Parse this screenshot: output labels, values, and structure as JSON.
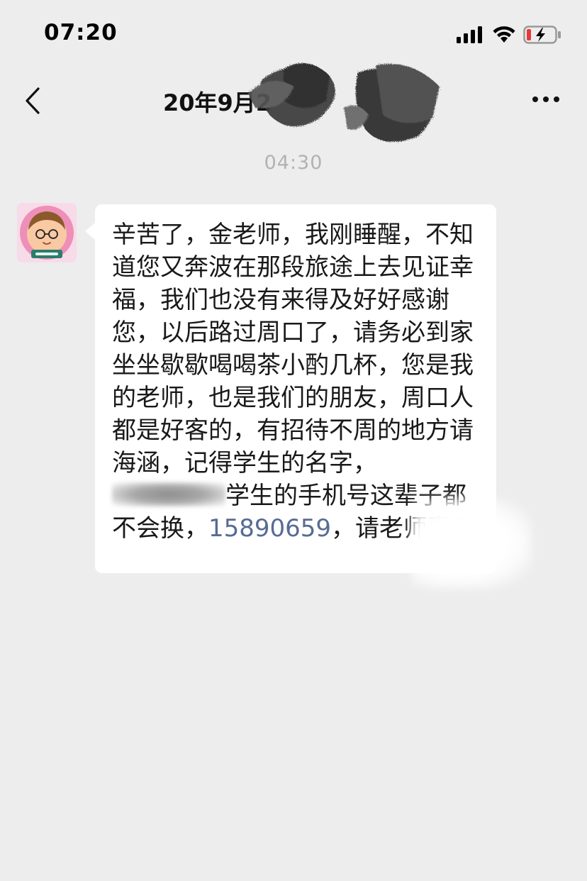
{
  "status_bar": {
    "time": "07:20",
    "icons": [
      "signal-icon",
      "wifi-icon",
      "battery-charging-icon"
    ],
    "battery_color": "#e53935"
  },
  "header": {
    "title": "20年9月2",
    "back_icon": "chevron-left-icon",
    "more_icon": "more-dots-icon"
  },
  "chat": {
    "timestamp": "04:30",
    "messages": [
      {
        "sender": "other",
        "avatar": "cartoon-teacher-avatar",
        "text_part1": "辛苦了，金老师，我刚睡醒，不知道您又奔波在那段旅途上去见证幸福，我们也没有来得及好好感谢您，以后路过周口了，请务必到家坐坐歇歇喝喝茶小酌几杯，您是我的老师，也是我们的朋友，周口人都是好客的，有招待不周的地方请海涵，记得学生的名字，",
        "text_part2": "学生的手机号这辈子都不会换，",
        "phone": "15890659",
        "text_part3": "，请老师惠存"
      }
    ]
  },
  "colors": {
    "background": "#ededed",
    "bubble": "#ffffff",
    "link": "#576b95",
    "timestamp": "#b2b2b2"
  }
}
